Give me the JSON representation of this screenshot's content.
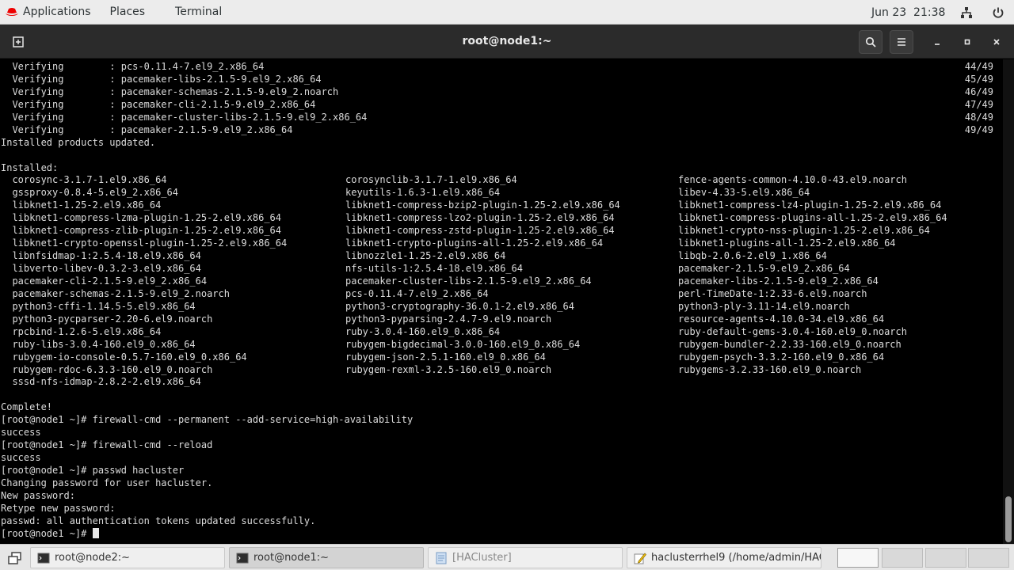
{
  "topbar": {
    "applications": "Applications",
    "places": "Places",
    "terminal": "Terminal",
    "clock": "Jun 23  21:38"
  },
  "window": {
    "title": "root@node1:~"
  },
  "terminal": {
    "lines": [
      [
        {
          "t": "  Verifying        : pcs-0.11.4-7.el9_2.x86_64"
        },
        {
          "t": "44/49",
          "r": true
        }
      ],
      [
        {
          "t": "  Verifying        : pacemaker-libs-2.1.5-9.el9_2.x86_64"
        },
        {
          "t": "45/49",
          "r": true
        }
      ],
      [
        {
          "t": "  Verifying        : pacemaker-schemas-2.1.5-9.el9_2.noarch"
        },
        {
          "t": "46/49",
          "r": true
        }
      ],
      [
        {
          "t": "  Verifying        : pacemaker-cli-2.1.5-9.el9_2.x86_64"
        },
        {
          "t": "47/49",
          "r": true
        }
      ],
      [
        {
          "t": "  Verifying        : pacemaker-cluster-libs-2.1.5-9.el9_2.x86_64"
        },
        {
          "t": "48/49",
          "r": true
        }
      ],
      [
        {
          "t": "  Verifying        : pacemaker-2.1.5-9.el9_2.x86_64"
        },
        {
          "t": "49/49",
          "r": true
        }
      ],
      [
        {
          "t": "Installed products updated."
        }
      ],
      [
        {
          "t": ""
        }
      ],
      [
        {
          "t": "Installed:"
        }
      ],
      [
        {
          "t": "  corosync-3.1.7-1.el9.x86_64"
        },
        {
          "t": "corosynclib-3.1.7-1.el9.x86_64",
          "col": 2
        },
        {
          "t": "fence-agents-common-4.10.0-43.el9.noarch",
          "col": 3
        }
      ],
      [
        {
          "t": "  gssproxy-0.8.4-5.el9_2.x86_64"
        },
        {
          "t": "keyutils-1.6.3-1.el9.x86_64",
          "col": 2
        },
        {
          "t": "libev-4.33-5.el9.x86_64",
          "col": 3
        }
      ],
      [
        {
          "t": "  libknet1-1.25-2.el9.x86_64"
        },
        {
          "t": "libknet1-compress-bzip2-plugin-1.25-2.el9.x86_64",
          "col": 2
        },
        {
          "t": "libknet1-compress-lz4-plugin-1.25-2.el9.x86_64",
          "col": 3
        }
      ],
      [
        {
          "t": "  libknet1-compress-lzma-plugin-1.25-2.el9.x86_64"
        },
        {
          "t": "libknet1-compress-lzo2-plugin-1.25-2.el9.x86_64",
          "col": 2
        },
        {
          "t": "libknet1-compress-plugins-all-1.25-2.el9.x86_64",
          "col": 3
        }
      ],
      [
        {
          "t": "  libknet1-compress-zlib-plugin-1.25-2.el9.x86_64"
        },
        {
          "t": "libknet1-compress-zstd-plugin-1.25-2.el9.x86_64",
          "col": 2
        },
        {
          "t": "libknet1-crypto-nss-plugin-1.25-2.el9.x86_64",
          "col": 3
        }
      ],
      [
        {
          "t": "  libknet1-crypto-openssl-plugin-1.25-2.el9.x86_64"
        },
        {
          "t": "libknet1-crypto-plugins-all-1.25-2.el9.x86_64",
          "col": 2
        },
        {
          "t": "libknet1-plugins-all-1.25-2.el9.x86_64",
          "col": 3
        }
      ],
      [
        {
          "t": "  libnfsidmap-1:2.5.4-18.el9.x86_64"
        },
        {
          "t": "libnozzle1-1.25-2.el9.x86_64",
          "col": 2
        },
        {
          "t": "libqb-2.0.6-2.el9_1.x86_64",
          "col": 3
        }
      ],
      [
        {
          "t": "  libverto-libev-0.3.2-3.el9.x86_64"
        },
        {
          "t": "nfs-utils-1:2.5.4-18.el9.x86_64",
          "col": 2
        },
        {
          "t": "pacemaker-2.1.5-9.el9_2.x86_64",
          "col": 3
        }
      ],
      [
        {
          "t": "  pacemaker-cli-2.1.5-9.el9_2.x86_64"
        },
        {
          "t": "pacemaker-cluster-libs-2.1.5-9.el9_2.x86_64",
          "col": 2
        },
        {
          "t": "pacemaker-libs-2.1.5-9.el9_2.x86_64",
          "col": 3
        }
      ],
      [
        {
          "t": "  pacemaker-schemas-2.1.5-9.el9_2.noarch"
        },
        {
          "t": "pcs-0.11.4-7.el9_2.x86_64",
          "col": 2
        },
        {
          "t": "perl-TimeDate-1:2.33-6.el9.noarch",
          "col": 3
        }
      ],
      [
        {
          "t": "  python3-cffi-1.14.5-5.el9.x86_64"
        },
        {
          "t": "python3-cryptography-36.0.1-2.el9.x86_64",
          "col": 2
        },
        {
          "t": "python3-ply-3.11-14.el9.noarch",
          "col": 3
        }
      ],
      [
        {
          "t": "  python3-pycparser-2.20-6.el9.noarch"
        },
        {
          "t": "python3-pyparsing-2.4.7-9.el9.noarch",
          "col": 2
        },
        {
          "t": "resource-agents-4.10.0-34.el9.x86_64",
          "col": 3
        }
      ],
      [
        {
          "t": "  rpcbind-1.2.6-5.el9.x86_64"
        },
        {
          "t": "ruby-3.0.4-160.el9_0.x86_64",
          "col": 2
        },
        {
          "t": "ruby-default-gems-3.0.4-160.el9_0.noarch",
          "col": 3
        }
      ],
      [
        {
          "t": "  ruby-libs-3.0.4-160.el9_0.x86_64"
        },
        {
          "t": "rubygem-bigdecimal-3.0.0-160.el9_0.x86_64",
          "col": 2
        },
        {
          "t": "rubygem-bundler-2.2.33-160.el9_0.noarch",
          "col": 3
        }
      ],
      [
        {
          "t": "  rubygem-io-console-0.5.7-160.el9_0.x86_64"
        },
        {
          "t": "rubygem-json-2.5.1-160.el9_0.x86_64",
          "col": 2
        },
        {
          "t": "rubygem-psych-3.3.2-160.el9_0.x86_64",
          "col": 3
        }
      ],
      [
        {
          "t": "  rubygem-rdoc-6.3.3-160.el9_0.noarch"
        },
        {
          "t": "rubygem-rexml-3.2.5-160.el9_0.noarch",
          "col": 2
        },
        {
          "t": "rubygems-3.2.33-160.el9_0.noarch",
          "col": 3
        }
      ],
      [
        {
          "t": "  sssd-nfs-idmap-2.8.2-2.el9.x86_64"
        }
      ],
      [
        {
          "t": ""
        }
      ],
      [
        {
          "t": "Complete!"
        }
      ],
      [
        {
          "t": "[root@node1 ~]# firewall-cmd --permanent --add-service=high-availability"
        }
      ],
      [
        {
          "t": "success"
        }
      ],
      [
        {
          "t": "[root@node1 ~]# firewall-cmd --reload"
        }
      ],
      [
        {
          "t": "success"
        }
      ],
      [
        {
          "t": "[root@node1 ~]# passwd hacluster"
        }
      ],
      [
        {
          "t": "Changing password for user hacluster."
        }
      ],
      [
        {
          "t": "New password:"
        }
      ],
      [
        {
          "t": "Retype new password:"
        }
      ],
      [
        {
          "t": "passwd: all authentication tokens updated successfully."
        }
      ],
      [
        {
          "t": "[root@node1 ~]# ",
          "cursor": true
        }
      ]
    ]
  },
  "taskbar": {
    "tasks": [
      {
        "label": "root@node2:~",
        "icon": "terminal-icon"
      },
      {
        "label": "root@node1:~",
        "icon": "terminal-icon"
      },
      {
        "label": "[HACluster]",
        "icon": "window-icon"
      },
      {
        "label": "haclusterrhel9 (/home/admin/HAC…",
        "icon": "text-editor-icon"
      }
    ]
  }
}
